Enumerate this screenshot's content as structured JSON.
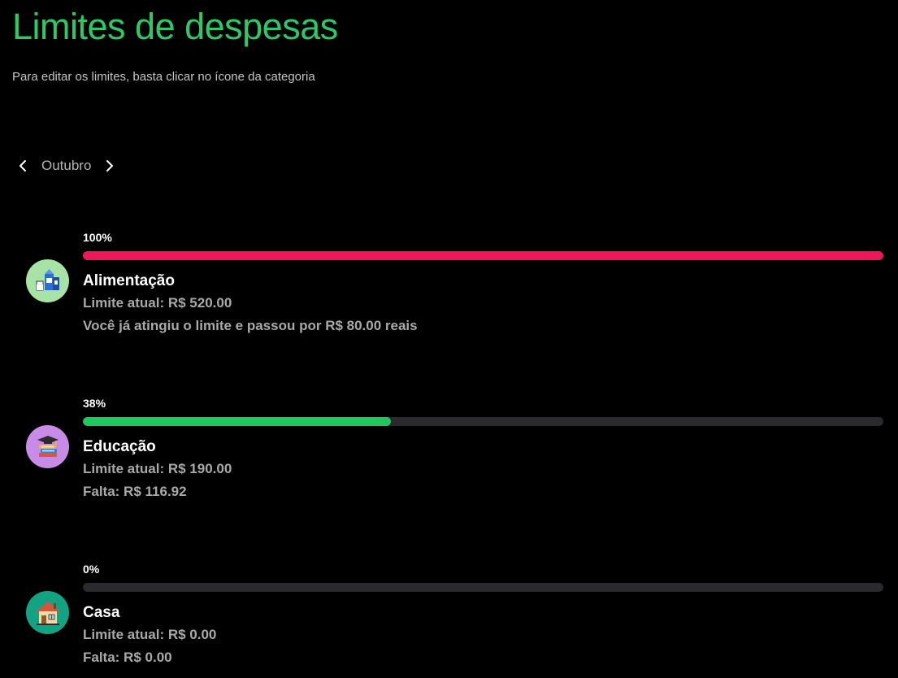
{
  "header": {
    "title": "Limites de despesas",
    "subtitle": "Para editar os limites, basta clicar no ícone da categoria"
  },
  "month_nav": {
    "month": "Outubro",
    "prev_icon": "chevron-left-icon",
    "next_icon": "chevron-right-icon"
  },
  "categories": [
    {
      "percent": "100%",
      "progress": 1.0,
      "bar_color": "#f0165a",
      "icon": "grocery-icon",
      "icon_bg": "#a7e3a4",
      "name": "Alimentação",
      "limit": "Limite atual: R$ 520.00",
      "note": "Você já atingiu o limite e passou por R$ 80.00 reais"
    },
    {
      "percent": "38%",
      "progress": 0.385,
      "bar_color": "#22c55e",
      "icon": "books-graduation-cap-icon",
      "icon_bg": "#c98be8",
      "name": "Educação",
      "limit": "Limite atual: R$ 190.00",
      "note": "Falta: R$ 116.92"
    },
    {
      "percent": "0%",
      "progress": 0,
      "bar_color": "#22c55e",
      "icon": "house-icon",
      "icon_bg": "#12a383",
      "name": "Casa",
      "limit": "Limite atual: R$ 0.00",
      "note": "Falta: R$ 0.00"
    }
  ],
  "colors": {
    "accent": "#2ec866",
    "background": "#000000",
    "track": "#2a2a2e"
  }
}
